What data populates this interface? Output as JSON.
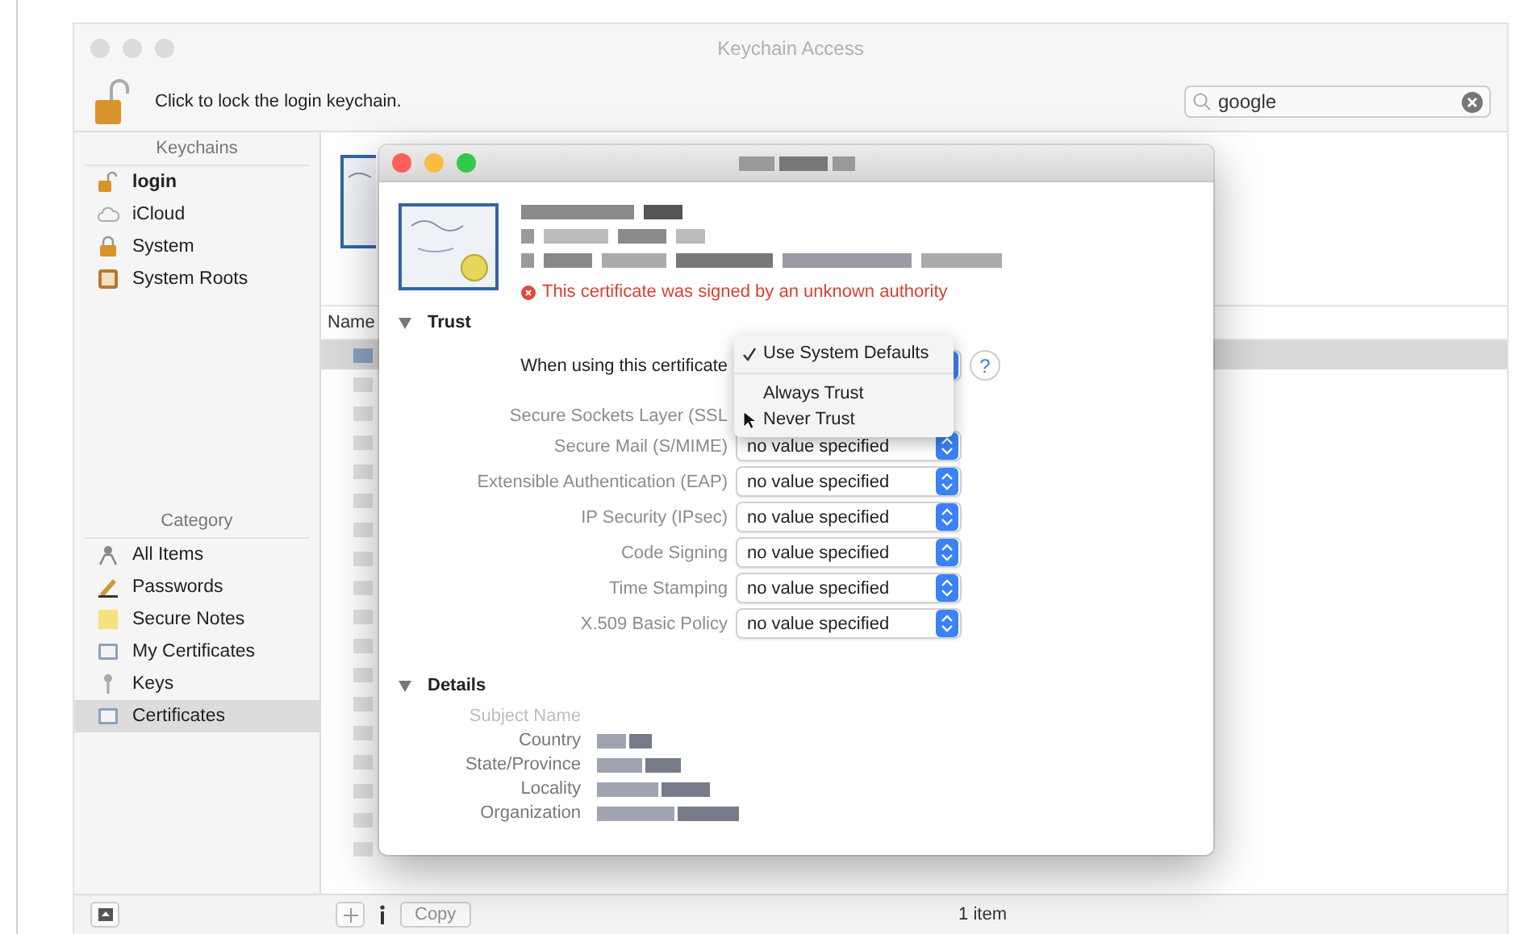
{
  "window": {
    "title": "Keychain Access"
  },
  "toolbar": {
    "lock_label": "Click to lock the login keychain.",
    "search": {
      "value": "google"
    }
  },
  "sidebar": {
    "keychains": {
      "header": "Keychains",
      "items": [
        {
          "label": "login",
          "kind": "lock-open",
          "selected": true
        },
        {
          "label": "iCloud",
          "kind": "cloud",
          "selected": false
        },
        {
          "label": "System",
          "kind": "lock",
          "selected": false
        },
        {
          "label": "System Roots",
          "kind": "cabinet",
          "selected": false
        }
      ]
    },
    "category": {
      "header": "Category",
      "items": [
        {
          "label": "All Items",
          "kind": "all",
          "selected": false
        },
        {
          "label": "Passwords",
          "kind": "pen",
          "selected": false
        },
        {
          "label": "Secure Notes",
          "kind": "note",
          "selected": false
        },
        {
          "label": "My Certificates",
          "kind": "cert",
          "selected": false
        },
        {
          "label": "Keys",
          "kind": "key",
          "selected": false
        },
        {
          "label": "Certificates",
          "kind": "cert",
          "selected": true
        }
      ]
    }
  },
  "list": {
    "columns": [
      "Name"
    ]
  },
  "dialog": {
    "error": "This certificate was signed by an unknown authority",
    "trust": {
      "title": "Trust",
      "expanded": true,
      "when_using_label": "When using this certificate",
      "help": "?",
      "menu": {
        "items": [
          {
            "label": "Use System Defaults",
            "selected": true
          },
          {
            "label": "Always Trust",
            "selected": false
          },
          {
            "label": "Never Trust",
            "selected": false
          }
        ]
      },
      "rows": [
        {
          "label": "Secure Sockets Layer (SSL",
          "disabled": true
        },
        {
          "label": "Secure Mail (S/MIME)",
          "value": "no value specified",
          "disabled": true
        },
        {
          "label": "Extensible Authentication (EAP)",
          "value": "no value specified",
          "disabled": true
        },
        {
          "label": "IP Security (IPsec)",
          "value": "no value specified",
          "disabled": true
        },
        {
          "label": "Code Signing",
          "value": "no value specified",
          "disabled": true
        },
        {
          "label": "Time Stamping",
          "value": "no value specified",
          "disabled": true
        },
        {
          "label": "X.509 Basic Policy",
          "value": "no value specified",
          "disabled": true
        }
      ]
    },
    "details": {
      "title": "Details",
      "expanded": true,
      "fields": [
        {
          "label": "Subject Name",
          "kind": "heading"
        },
        {
          "label": "Country",
          "kind": "field"
        },
        {
          "label": "State/Province",
          "kind": "field"
        },
        {
          "label": "Locality",
          "kind": "field"
        },
        {
          "label": "Organization",
          "kind": "field"
        }
      ]
    }
  },
  "status_bar": {
    "copy_button": {
      "label": "Copy",
      "disabled": true
    },
    "count": "1 item"
  }
}
